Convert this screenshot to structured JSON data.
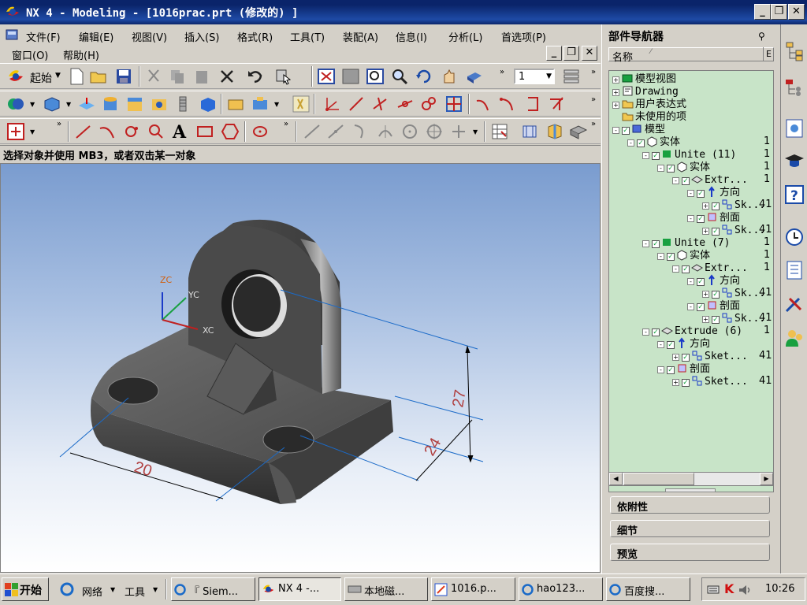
{
  "window": {
    "title": "NX 4 - Modeling - [1016prac.prt  (修改的) ]",
    "buttons": [
      "_",
      "❐",
      "✕"
    ]
  },
  "menu": {
    "row1": [
      "文件(F)",
      "编辑(E)",
      "视图(V)",
      "插入(S)",
      "格式(R)",
      "工具(T)",
      "装配(A)",
      "信息(I)",
      "分析(L)",
      "首选项(P)"
    ],
    "row2": [
      "窗口(O)",
      "帮助(H)"
    ],
    "doc_buttons": [
      "_",
      "❐",
      "✕"
    ]
  },
  "toolbar": {
    "start_label": "起始",
    "layer_value": "1"
  },
  "status_text": "选择对象并使用 MB3，或者双击某一对象",
  "viewport": {
    "axis": {
      "zc": "ZC",
      "yc": "YC",
      "xc": "XC"
    },
    "dims": {
      "d20": "20",
      "d24": "24",
      "d27": "27"
    }
  },
  "navigator": {
    "title": "部件导航器",
    "column": "名称",
    "nodes": [
      {
        "text": "模型视图",
        "num": ""
      },
      {
        "text": "Drawing",
        "num": ""
      },
      {
        "text": "用户表达式",
        "num": ""
      },
      {
        "text": "未使用的项",
        "num": ""
      },
      {
        "text": "模型",
        "num": ""
      },
      {
        "text": "实体",
        "num": "1"
      },
      {
        "text": "Unite (11)",
        "num": "1"
      },
      {
        "text": "实体",
        "num": "1"
      },
      {
        "text": "Extr...",
        "num": "1"
      },
      {
        "text": "方向",
        "num": ""
      },
      {
        "text": "Sk...",
        "num": "41"
      },
      {
        "text": "剖面",
        "num": ""
      },
      {
        "text": "Sk...",
        "num": "41"
      },
      {
        "text": "Unite (7)",
        "num": "1"
      },
      {
        "text": "实体",
        "num": "1"
      },
      {
        "text": "Extr...",
        "num": "1"
      },
      {
        "text": "方向",
        "num": ""
      },
      {
        "text": "Sk...",
        "num": "41"
      },
      {
        "text": "剖面",
        "num": ""
      },
      {
        "text": "Sk...",
        "num": "41"
      },
      {
        "text": "Extrude (6)",
        "num": "1"
      },
      {
        "text": "方向",
        "num": ""
      },
      {
        "text": "Sket...",
        "num": "41"
      },
      {
        "text": "剖面",
        "num": ""
      },
      {
        "text": "Sket...",
        "num": "41"
      }
    ],
    "panels": [
      "依附性",
      "细节",
      "预览"
    ]
  },
  "taskbar": {
    "start": "开始",
    "quick": [
      "网络",
      "工具"
    ],
    "tasks": [
      "『 Siem...",
      "NX 4 -...",
      "本地磁...",
      "1016.p...",
      "hao123...",
      "百度搜..."
    ],
    "clock": "10:26"
  }
}
